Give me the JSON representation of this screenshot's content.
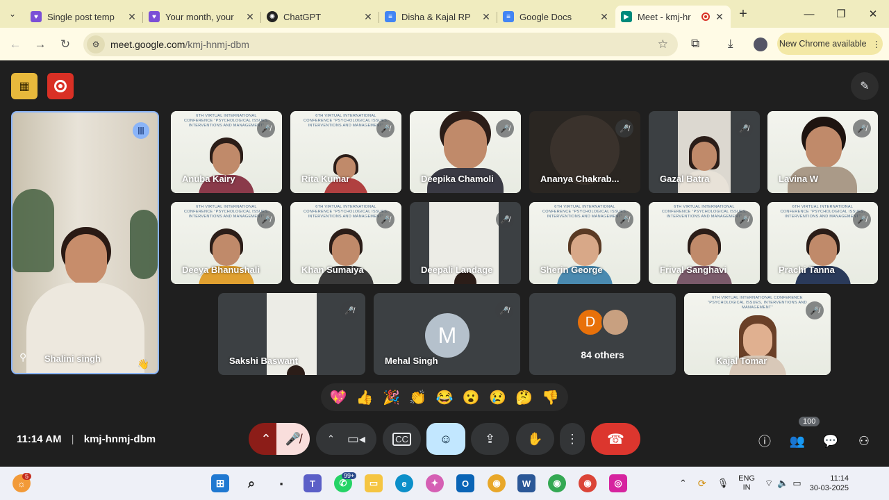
{
  "browser": {
    "tabs": [
      {
        "title": "Single post temp",
        "favicon": "canva-icon",
        "color": "#7b4fd6",
        "active": false
      },
      {
        "title": "Your month, your",
        "favicon": "canva-icon",
        "color": "#7b4fd6",
        "active": false
      },
      {
        "title": "ChatGPT",
        "favicon": "chatgpt-icon",
        "color": "#222222",
        "active": false
      },
      {
        "title": "Disha & Kajal RP",
        "favicon": "docs-icon",
        "color": "#4285f4",
        "active": false
      },
      {
        "title": "Google Docs",
        "favicon": "docs-icon",
        "color": "#4285f4",
        "active": false
      },
      {
        "title": "Meet - kmj-hr",
        "favicon": "meet-icon",
        "color": "#00897b",
        "active": true
      }
    ],
    "url_host": "meet.google.com",
    "url_path": "/kmj-hnmj-dbm",
    "new_chrome": "New Chrome available"
  },
  "meet": {
    "pinned": {
      "name": "Shalini singh"
    },
    "participants": [
      {
        "name": "Anuba Kairy"
      },
      {
        "name": "Rita Kumar"
      },
      {
        "name": "Deepika Chamoli"
      },
      {
        "name": "Ananya Chakrab..."
      },
      {
        "name": "Gazal Batra"
      },
      {
        "name": "Lavina W"
      },
      {
        "name": "Deeya Bhanushali"
      },
      {
        "name": "Khan Sumaiya"
      },
      {
        "name": "Deepali Landage"
      },
      {
        "name": "Sherin George"
      },
      {
        "name": "Frival Sanghavi"
      },
      {
        "name": "Prachi Tanna"
      },
      {
        "name": "Sakshi Baswant"
      },
      {
        "name": "Mehal Singh",
        "initial": "M"
      },
      {
        "name": "Kajal Tomar"
      }
    ],
    "others": {
      "label": "84 others",
      "initial": "D"
    },
    "slide_text": "6TH VIRTUAL INTERNATIONAL CONFERENCE \"PSYCHOLOGICAL ISSUES, INTERVENTIONS AND MANAGEMENT\"",
    "reactions": [
      "💖",
      "👍",
      "🎉",
      "👏",
      "😂",
      "😮",
      "😢",
      "🤔",
      "👎"
    ],
    "time": "11:14 AM",
    "meeting_code": "kmj-hnmj-dbm",
    "people_count": "100"
  },
  "taskbar": {
    "notification_badge": "5",
    "whatsapp_badge": "99+",
    "language": "ENG",
    "region": "IN",
    "clock_time": "11:14",
    "clock_date": "30-03-2025"
  },
  "colors": {
    "end_call": "#ea4335",
    "record": "#ea4335",
    "accent_blue": "#8ab4f8"
  }
}
